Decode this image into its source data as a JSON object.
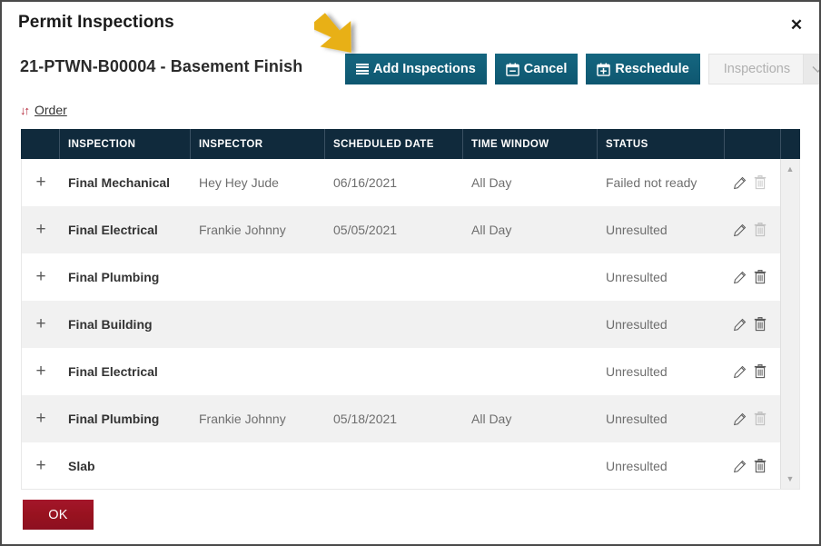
{
  "dialog": {
    "title": "Permit Inspections",
    "close_label": "✕",
    "permit_label": "21-PTWN-B00004 - Basement Finish",
    "ok_label": "OK"
  },
  "toolbar": {
    "add_inspections_label": "Add Inspections",
    "cancel_label": "Cancel",
    "reschedule_label": "Reschedule",
    "dropdown_value": "Inspections",
    "dropdown_arrow": "⌄"
  },
  "order": {
    "icon": "↓↑",
    "label": "Order"
  },
  "table": {
    "columns": [
      {
        "key": "expand",
        "label": ""
      },
      {
        "key": "inspection",
        "label": "INSPECTION"
      },
      {
        "key": "inspector",
        "label": "INSPECTOR"
      },
      {
        "key": "scheduled_date",
        "label": "SCHEDULED DATE"
      },
      {
        "key": "time_window",
        "label": "TIME WINDOW"
      },
      {
        "key": "status",
        "label": "STATUS"
      },
      {
        "key": "actions",
        "label": ""
      }
    ],
    "expand_glyph": "+",
    "rows": [
      {
        "inspection": "Final Mechanical",
        "inspector": "Hey Hey Jude",
        "scheduled_date": "06/16/2021",
        "time_window": "All Day",
        "status": "Failed not ready",
        "delete_enabled": false
      },
      {
        "inspection": "Final Electrical",
        "inspector": "Frankie Johnny",
        "scheduled_date": "05/05/2021",
        "time_window": "All Day",
        "status": "Unresulted",
        "delete_enabled": false
      },
      {
        "inspection": "Final Plumbing",
        "inspector": "",
        "scheduled_date": "",
        "time_window": "",
        "status": "Unresulted",
        "delete_enabled": true
      },
      {
        "inspection": "Final Building",
        "inspector": "",
        "scheduled_date": "",
        "time_window": "",
        "status": "Unresulted",
        "delete_enabled": true
      },
      {
        "inspection": "Final Electrical",
        "inspector": "",
        "scheduled_date": "",
        "time_window": "",
        "status": "Unresulted",
        "delete_enabled": true
      },
      {
        "inspection": "Final Plumbing",
        "inspector": "Frankie Johnny",
        "scheduled_date": "05/18/2021",
        "time_window": "All Day",
        "status": "Unresulted",
        "delete_enabled": false
      },
      {
        "inspection": "Slab",
        "inspector": "",
        "scheduled_date": "",
        "time_window": "",
        "status": "Unresulted",
        "delete_enabled": true
      }
    ]
  },
  "scrollbar": {
    "up_glyph": "▲",
    "down_glyph": "▼"
  },
  "annotation": {
    "arrow_color": "#e8b019",
    "points_at": "Add Inspections"
  },
  "colors": {
    "header_bg": "#102a3c",
    "button_teal": "#10667e",
    "ok_red": "#9a1322",
    "row_alt": "#f1f1f1",
    "order_icon_red": "#b22234"
  }
}
